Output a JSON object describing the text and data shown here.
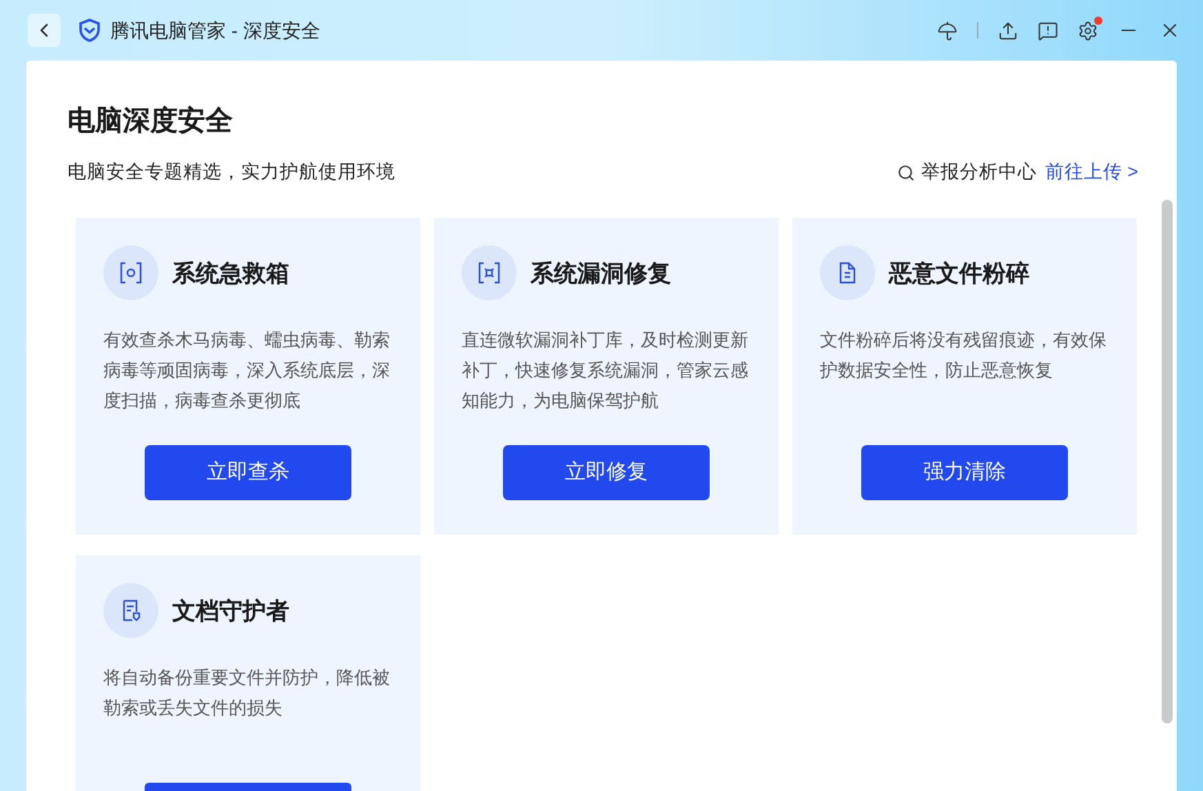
{
  "window": {
    "title": "腾讯电脑管家 - 深度安全",
    "settings_badge": true
  },
  "page": {
    "heading": "电脑深度安全",
    "subtitle": "电脑安全专题精选，实力护航使用环境",
    "report_label": "举报分析中心",
    "report_link": "前往上传 >"
  },
  "cards": [
    {
      "title": "系统急救箱",
      "description": "有效查杀木马病毒、蠕虫病毒、勒索病毒等顽固病毒，深入系统底层，深度扫描，病毒查杀更彻底",
      "button": {
        "kind": "full",
        "label": "立即查杀"
      }
    },
    {
      "title": "系统漏洞修复",
      "description": "直连微软漏洞补丁库，及时检测更新补丁，快速修复系统漏洞，管家云感知能力，为电脑保驾护航",
      "button": {
        "kind": "full",
        "label": "立即修复"
      }
    },
    {
      "title": "恶意文件粉碎",
      "description": "文件粉碎后将没有残留痕迹，有效保护数据安全性，防止恶意恢复",
      "button": {
        "kind": "full",
        "label": "强力清除"
      }
    },
    {
      "title": "文档守护者",
      "description": "将自动备份重要文件并防护，降低被勒索或丢失文件的损失",
      "button": {
        "kind": "cut"
      }
    }
  ]
}
